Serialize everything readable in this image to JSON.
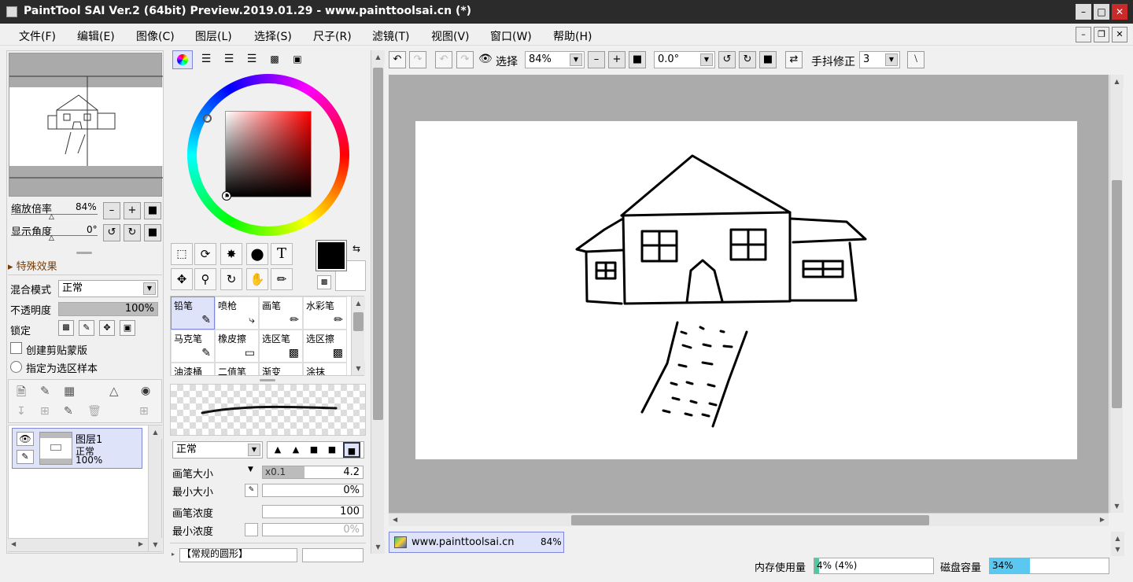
{
  "window": {
    "title": "PaintTool SAI Ver.2 (64bit) Preview.2019.01.29 - www.painttoolsai.cn (*)"
  },
  "menu": [
    "文件(F)",
    "编辑(E)",
    "图像(C)",
    "图层(L)",
    "选择(S)",
    "尺子(R)",
    "滤镜(T)",
    "视图(V)",
    "窗口(W)",
    "帮助(H)"
  ],
  "navigator": {
    "zoom_label": "缩放倍率",
    "zoom_value": "84%",
    "angle_label": "显示角度",
    "angle_value": "0°"
  },
  "layer_props": {
    "effects_label": "特殊效果",
    "blend_label": "混合模式",
    "blend_value": "正常",
    "opacity_label": "不透明度",
    "opacity_value": "100%",
    "opacity": 1.0,
    "lock_label": "锁定",
    "clip_label": "创建剪贴蒙版",
    "sample_label": "指定为选区样本"
  },
  "layers": [
    {
      "name": "图层1",
      "mode": "正常",
      "opacity": "100%"
    }
  ],
  "tools": {
    "text_tool": "T"
  },
  "brushes": [
    {
      "name": "铅笔",
      "selected": true
    },
    {
      "name": "喷枪"
    },
    {
      "name": "画笔"
    },
    {
      "name": "水彩笔"
    },
    {
      "name": "马克笔"
    },
    {
      "name": "橡皮擦"
    },
    {
      "name": "选区笔"
    },
    {
      "name": "选区擦"
    },
    {
      "name": "油漆桶"
    },
    {
      "name": "二值笔"
    },
    {
      "name": "渐变"
    },
    {
      "name": "涂抹"
    }
  ],
  "brush_settings": {
    "mode_value": "正常",
    "size_label": "画笔大小",
    "size_multiplier": "x0.1",
    "size_value": "4.2",
    "size_fill": 0.42,
    "min_size_label": "最小大小",
    "min_size_value": "0%",
    "density_label": "画笔浓度",
    "density_value": "100",
    "min_density_label": "最小浓度",
    "min_density_value": "0%",
    "shape_label": "【常规的圆形】"
  },
  "toolbar": {
    "select_label": "选择",
    "zoom_value": "84%",
    "angle_value": "0.0°",
    "stabilizer_label": "手抖修正",
    "stabilizer_value": "3"
  },
  "document_tab": {
    "name": "www.painttoolsai.cn",
    "zoom": "84%"
  },
  "status": {
    "memory_label": "内存使用量",
    "memory_value": "4% (4%)",
    "memory_fill": 0.04,
    "disk_label": "磁盘容量",
    "disk_value": "34%",
    "disk_fill": 0.34
  },
  "colors": {
    "primary": "#000000",
    "secondary": "#ffffff",
    "accent": "#dfe3fa"
  }
}
